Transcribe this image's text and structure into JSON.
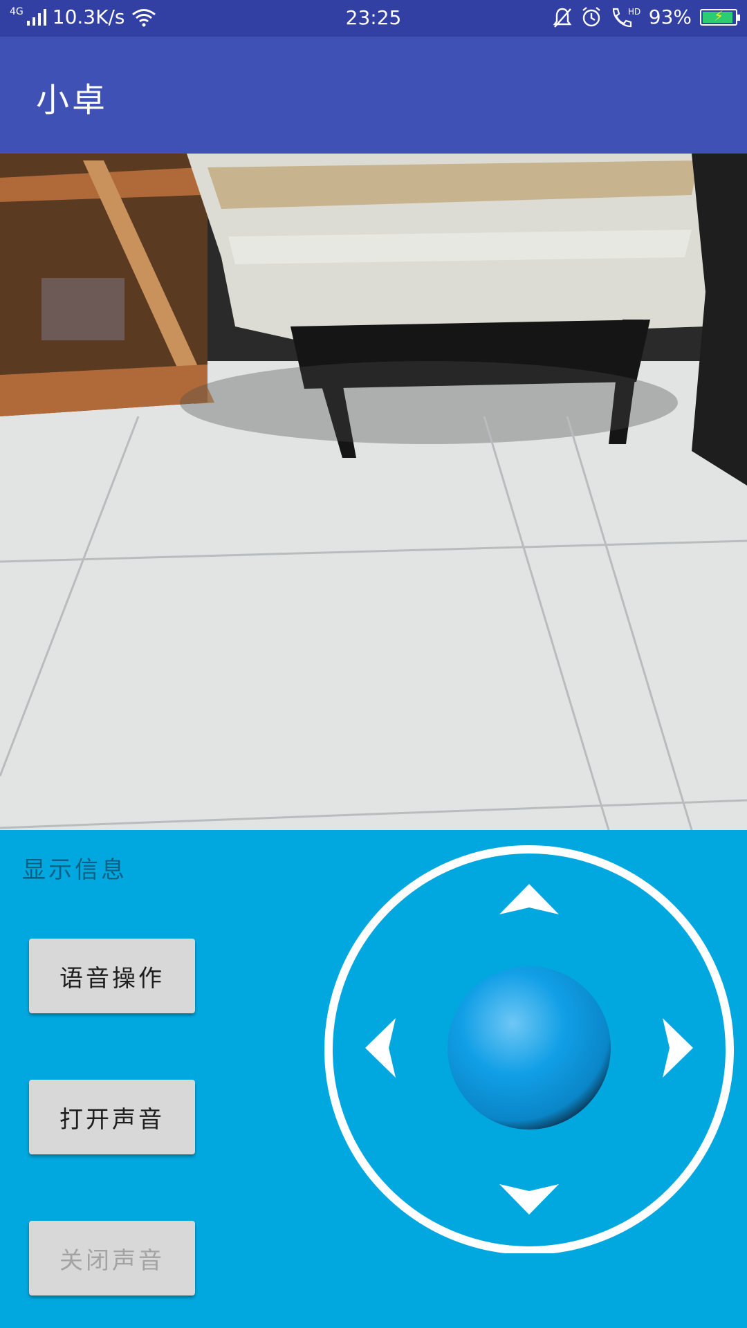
{
  "status_bar": {
    "network_type": "4G",
    "speed": "10.3K/s",
    "time": "23:25",
    "battery_percent": "93%",
    "battery_level": 0.93,
    "icons": [
      "signal-icon",
      "wifi-icon",
      "mute-bell-icon",
      "alarm-icon",
      "hd-call-icon",
      "battery-icon"
    ]
  },
  "app_bar": {
    "title": "小卓"
  },
  "info": {
    "label": "显示信息"
  },
  "buttons": {
    "voice": "语音操作",
    "sound_on": "打开声音",
    "sound_off": "关闭声音"
  },
  "joystick": {
    "icons": [
      "up-arrow-icon",
      "down-arrow-icon",
      "left-arrow-icon",
      "right-arrow-icon",
      "joystick-knob"
    ]
  },
  "colors": {
    "status_bar": "#3340a3",
    "app_bar": "#3f51b5",
    "control_panel": "#00a8df",
    "button": "#d8d8d8",
    "knob": "#0a9ce6"
  }
}
